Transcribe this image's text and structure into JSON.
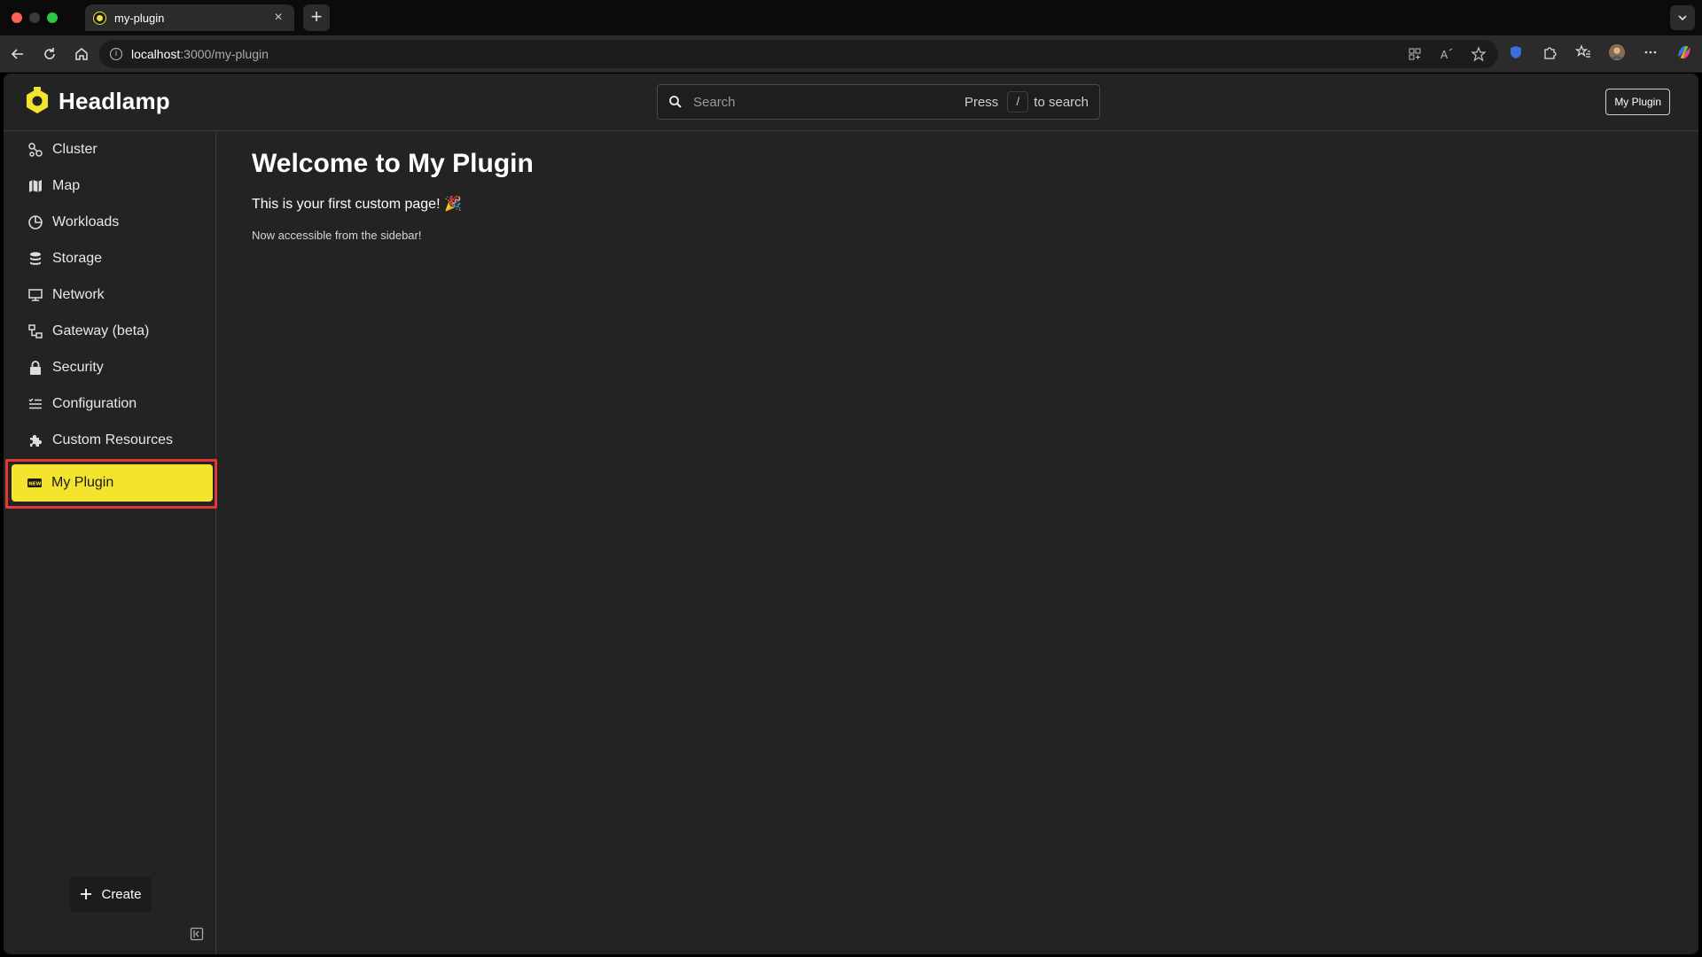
{
  "browser": {
    "tab_title": "my-plugin",
    "tab_close": "×",
    "new_tab": "+",
    "url_host": "localhost",
    "url_path": ":3000/my-plugin"
  },
  "app": {
    "brand": "Headlamp",
    "search": {
      "placeholder": "Search",
      "hint_press": "Press",
      "hint_key": "/",
      "hint_suffix": "to search"
    },
    "header_button": "My Plugin"
  },
  "sidebar": {
    "items": [
      {
        "label": "Cluster",
        "icon": "cluster-icon"
      },
      {
        "label": "Map",
        "icon": "map-icon"
      },
      {
        "label": "Workloads",
        "icon": "workloads-icon"
      },
      {
        "label": "Storage",
        "icon": "storage-icon"
      },
      {
        "label": "Network",
        "icon": "network-icon"
      },
      {
        "label": "Gateway (beta)",
        "icon": "gateway-icon"
      },
      {
        "label": "Security",
        "icon": "lock-icon"
      },
      {
        "label": "Configuration",
        "icon": "configuration-icon"
      },
      {
        "label": "Custom Resources",
        "icon": "puzzle-icon"
      }
    ],
    "active_item": {
      "label": "My Plugin",
      "icon": "new-badge-icon"
    },
    "create_label": "Create"
  },
  "main": {
    "title": "Welcome to My Plugin",
    "line1": "This is your first custom page! 🎉",
    "line2": "Now accessible from the sidebar!"
  },
  "colors": {
    "accent": "#f5e42e",
    "highlight_border": "#e53935",
    "background": "#232323"
  }
}
